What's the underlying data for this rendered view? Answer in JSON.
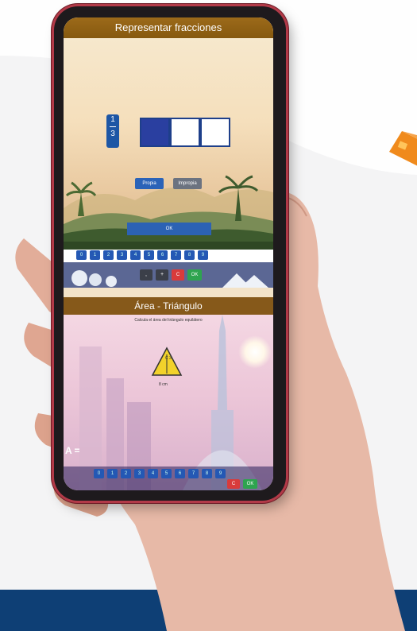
{
  "colors": {
    "background": "#f4f4f5",
    "bottom_band": "#0e3f75",
    "accent_orange": "#f08a1c",
    "app_blue": "#2458b4",
    "header_brown": "#86591a"
  },
  "app1": {
    "title": "Representar fracciones",
    "fraction": {
      "numerator": "1",
      "denominator": "3"
    },
    "fraction_bar_filled": 1,
    "fraction_bar_total": 3,
    "buttons": {
      "proper": "Propia",
      "improper": "Impropia"
    },
    "ok_label": "OK",
    "keypad": {
      "digits": [
        "0",
        "1",
        "2",
        "3",
        "4",
        "5",
        "6",
        "7",
        "8",
        "9"
      ],
      "extra": [
        ",",
        "+",
        "C",
        "OK"
      ]
    }
  },
  "app2": {
    "title": "Área - Triángulo",
    "instruction": "Calcula el área del triángulo equilátero",
    "triangle_side": "8 cm",
    "side_marker": "C 3",
    "answer_label": "A =",
    "keypad": {
      "digits": [
        "0",
        "1",
        "2",
        "3",
        "4",
        "5",
        "6",
        "7",
        "8",
        "9"
      ],
      "extra": [
        "C",
        "OK"
      ]
    }
  }
}
